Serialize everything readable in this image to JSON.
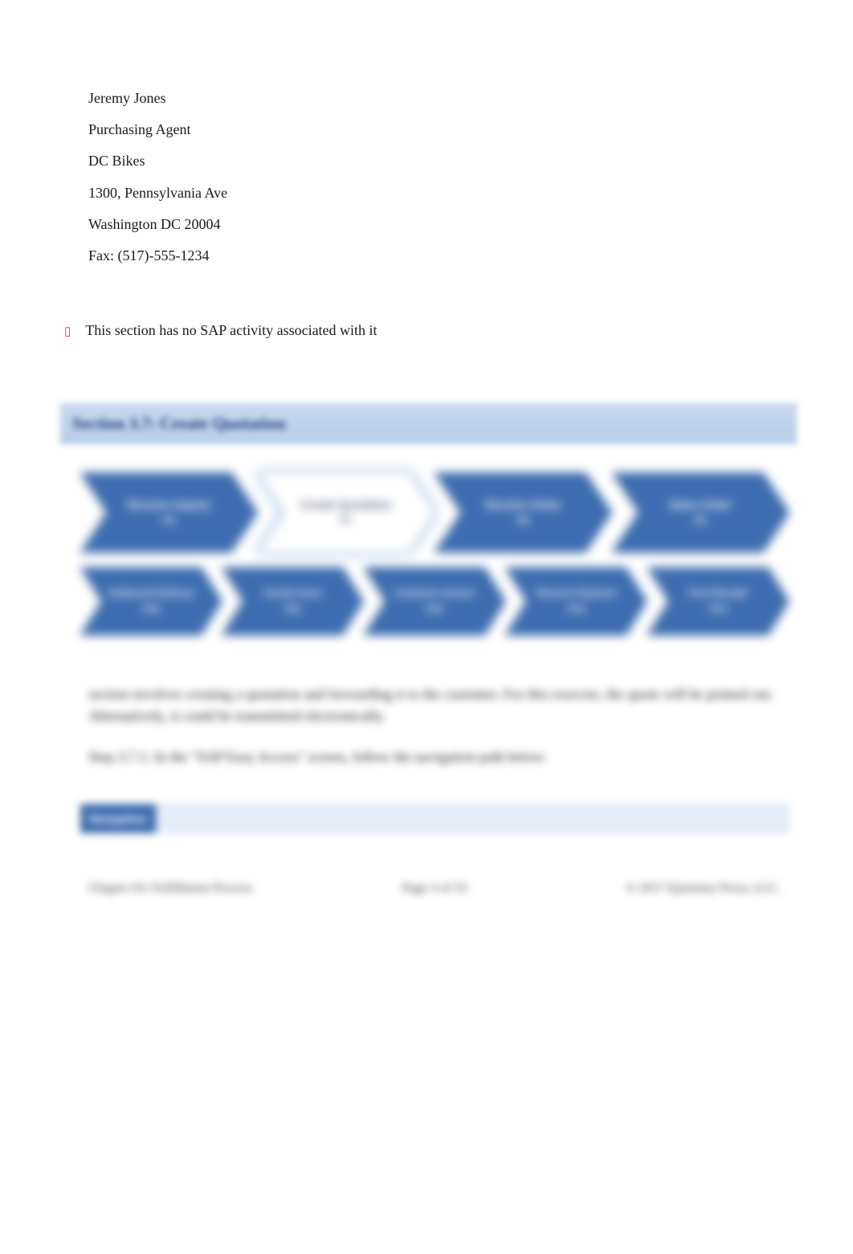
{
  "contact": {
    "name": "Jeremy Jones",
    "title": "Purchasing Agent",
    "company": "DC Bikes",
    "street": "1300, Pennsylvania Ave",
    "city_zip": "Washington DC 20004",
    "fax": "Fax: (517)-555-1234"
  },
  "note": {
    "icon": "▯",
    "text": "This section has no SAP activity associated with it"
  },
  "section_header": "Section 3.7: Create Quotation",
  "flow_row1": [
    {
      "title": "Receive Inquiry",
      "code": "P6",
      "mode": "blue"
    },
    {
      "title": "Create Quotation",
      "code": "P7",
      "mode": "active"
    },
    {
      "title": "Receive Order",
      "code": "P8",
      "mode": "blue"
    },
    {
      "title": "Sales Order",
      "code": "P9",
      "mode": "blue"
    }
  ],
  "flow_row2": [
    {
      "title": "Outbound Delivery",
      "code": "P10",
      "mode": "blue"
    },
    {
      "title": "Goods Issue",
      "code": "P11",
      "mode": "blue"
    },
    {
      "title": "Customer Invoice",
      "code": "P12",
      "mode": "blue"
    },
    {
      "title": "Receive Payment",
      "code": "P13",
      "mode": "blue"
    },
    {
      "title": "Post Receipt",
      "code": "P14",
      "mode": "blue"
    }
  ],
  "body": {
    "p1": "section involves creating a quotation and forwarding it to the customer. For this exercise, the quote will be printed out. Alternatively, it could be transmitted electronically.",
    "p2": "Step 3.7.1: In the \"SAP Easy Access\" screen, follow the navigation path below:"
  },
  "nav": {
    "label": "Navigation",
    "path": ""
  },
  "footer": {
    "left": "Chapter 03: Fulfillment Process",
    "center": "Page 3 of 53",
    "right": "© 2017 Epistemy Press, LLC."
  }
}
